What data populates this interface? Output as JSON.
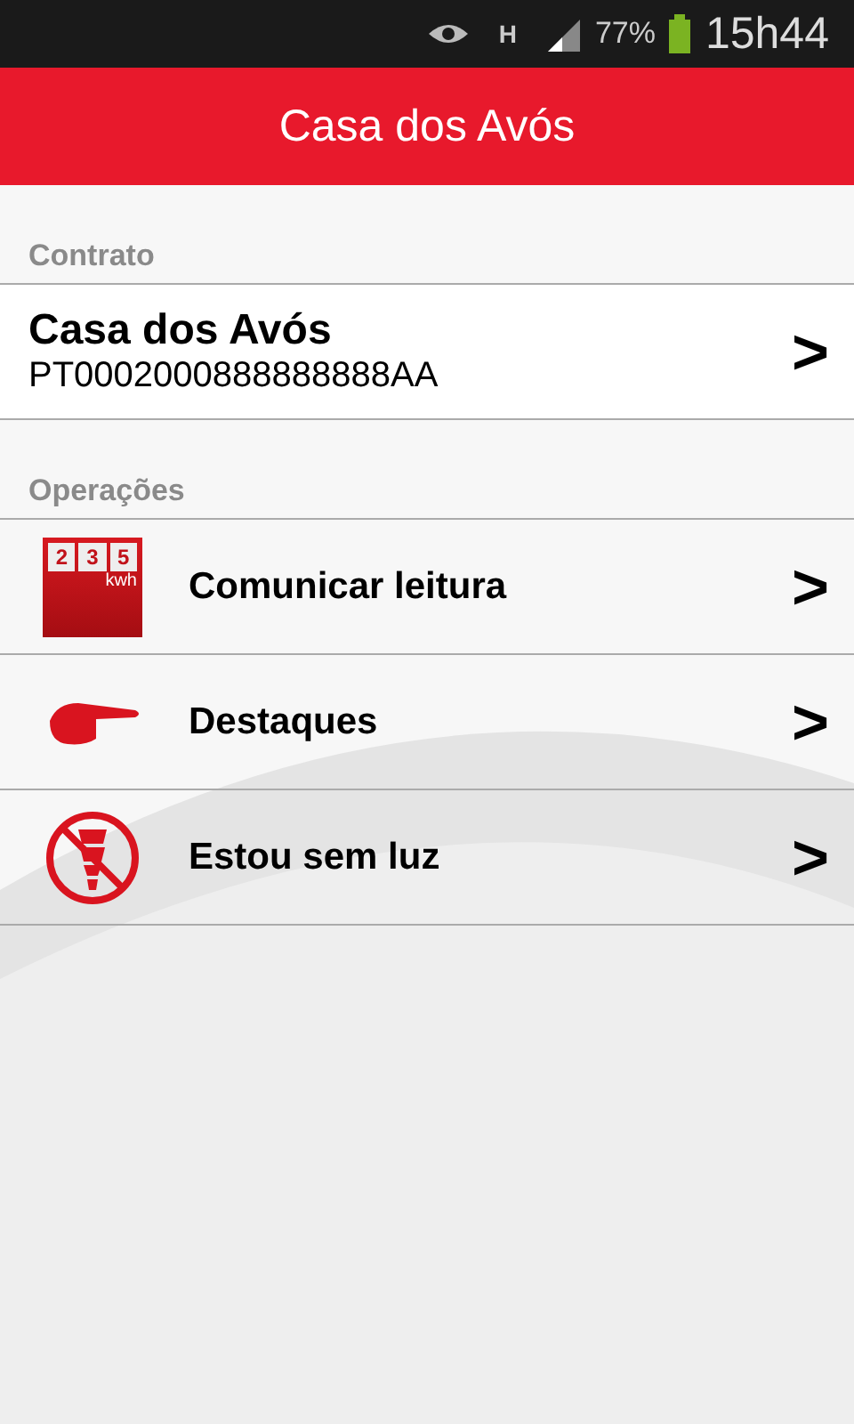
{
  "status_bar": {
    "network": "H",
    "battery": "77%",
    "time": "15h44"
  },
  "header": {
    "title": "Casa dos Avós"
  },
  "contract": {
    "label": "Contrato",
    "name": "Casa dos Avós",
    "code": "PT0002000888888888AA",
    "chevron": ">"
  },
  "operations": {
    "label": "Operações",
    "items": [
      {
        "kind": "meter",
        "label": "Comunicar leitura",
        "digits": [
          "2",
          "3",
          "5"
        ],
        "unit": "kwh",
        "chevron": ">"
      },
      {
        "kind": "pointer",
        "label": "Destaques",
        "chevron": ">"
      },
      {
        "kind": "nolight",
        "label": "Estou sem luz",
        "chevron": ">"
      }
    ]
  }
}
